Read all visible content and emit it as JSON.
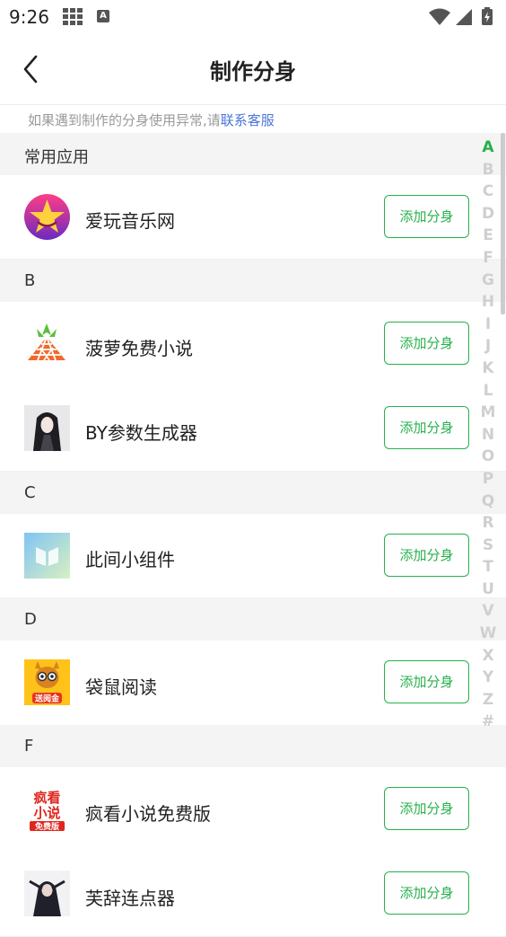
{
  "status_bar": {
    "time": "9:26"
  },
  "header": {
    "title": "制作分身"
  },
  "notice": {
    "text": "如果遇到制作的分身使用异常,请",
    "link": "联系客服"
  },
  "sections": [
    {
      "title": "常用应用",
      "apps": [
        {
          "name": "爱玩音乐网",
          "button": "添加分身"
        }
      ]
    },
    {
      "title": "B",
      "apps": [
        {
          "name": "菠萝免费小说",
          "button": "添加分身"
        },
        {
          "name": "BY参数生成器",
          "button": "添加分身"
        }
      ]
    },
    {
      "title": "C",
      "apps": [
        {
          "name": "此间小组件",
          "button": "添加分身"
        }
      ]
    },
    {
      "title": "D",
      "apps": [
        {
          "name": "袋鼠阅读",
          "button": "添加分身",
          "icon_text": "送阅金"
        }
      ]
    },
    {
      "title": "F",
      "apps": [
        {
          "name": "疯看小说免费版",
          "button": "添加分身",
          "icon_text_top": "疯看",
          "icon_text_mid": "小说",
          "icon_text_bottom": "免费版"
        },
        {
          "name": "芙辞连点器",
          "button": "添加分身"
        }
      ]
    }
  ],
  "index_letters": [
    "A",
    "B",
    "C",
    "D",
    "E",
    "F",
    "G",
    "H",
    "I",
    "J",
    "K",
    "L",
    "M",
    "N",
    "O",
    "P",
    "Q",
    "R",
    "S",
    "T",
    "U",
    "V",
    "W",
    "X",
    "Y",
    "Z",
    "#"
  ],
  "active_letter": "A",
  "colors": {
    "accent": "#27b04b",
    "link": "#4a76d8",
    "section_bg": "#f4f4f4"
  }
}
